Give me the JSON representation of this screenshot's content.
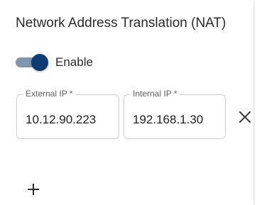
{
  "section": {
    "title": "Network Address Translation (NAT)"
  },
  "toggle": {
    "label": "Enable",
    "checked": true,
    "track_color": "#8096ad",
    "thumb_color": "#0b3d74"
  },
  "fields": {
    "external_ip": {
      "label": "External IP *",
      "value": "10.12.90.223"
    },
    "internal_ip": {
      "label": "Internal IP *",
      "value": "192.168.1.30"
    }
  },
  "icons": {
    "remove": "close-icon",
    "add": "plus-icon"
  }
}
